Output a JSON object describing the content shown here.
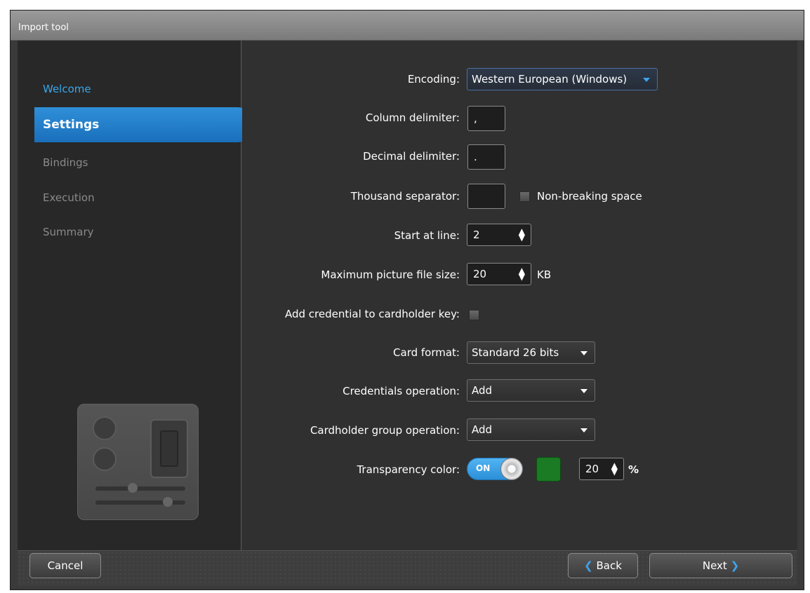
{
  "window": {
    "title": "Import tool"
  },
  "nav": {
    "items": [
      {
        "label": "Welcome",
        "state": "done"
      },
      {
        "label": "Settings",
        "state": "active"
      },
      {
        "label": "Bindings",
        "state": "pending"
      },
      {
        "label": "Execution",
        "state": "pending"
      },
      {
        "label": "Summary",
        "state": "pending"
      }
    ]
  },
  "form": {
    "encoding": {
      "label": "Encoding:",
      "value": "Western European (Windows)"
    },
    "column_delimiter": {
      "label": "Column delimiter:",
      "value": ","
    },
    "decimal_delimiter": {
      "label": "Decimal delimiter:",
      "value": "."
    },
    "thousand_separator": {
      "label": "Thousand separator:",
      "value": "",
      "checkbox_label": "Non-breaking space",
      "checked": false
    },
    "start_at_line": {
      "label": "Start at line:",
      "value": "2"
    },
    "max_picture_size": {
      "label": "Maximum picture file size:",
      "value": "20",
      "unit": "KB"
    },
    "add_credential": {
      "label": "Add credential to cardholder key:",
      "checked": false
    },
    "card_format": {
      "label": "Card format:",
      "value": "Standard 26 bits"
    },
    "credentials_operation": {
      "label": "Credentials operation:",
      "value": "Add"
    },
    "cardholder_group_operation": {
      "label": "Cardholder group operation:",
      "value": "Add"
    },
    "transparency": {
      "label": "Transparency color:",
      "toggle_text": "ON",
      "color": "#1b7a24",
      "percent_value": "20",
      "percent_unit": "%"
    }
  },
  "footer": {
    "cancel_label": "Cancel",
    "back_label": "Back",
    "next_label": "Next"
  },
  "colors": {
    "accent": "#2f8fd8",
    "link": "#39a7ea"
  }
}
